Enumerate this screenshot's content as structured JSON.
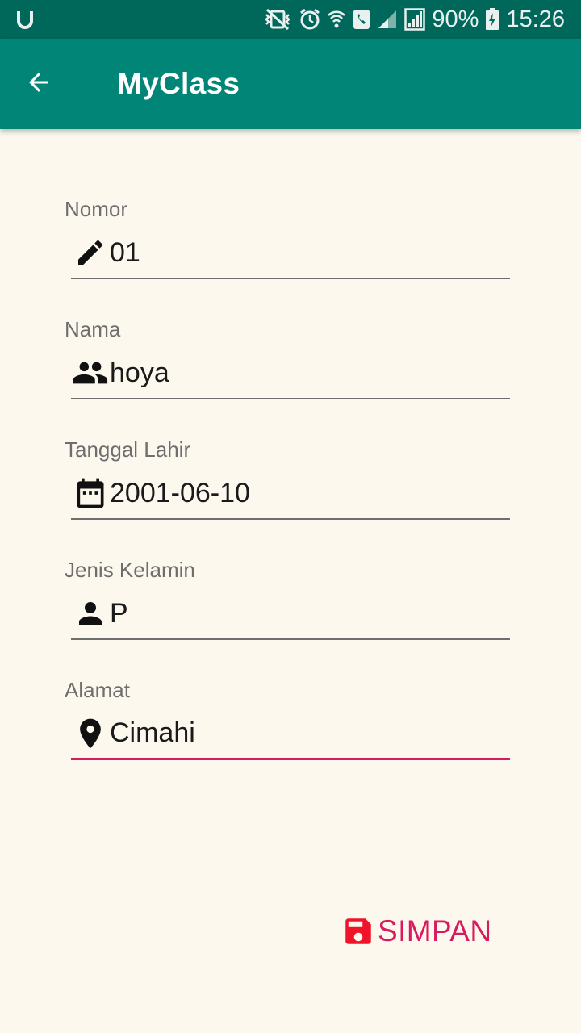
{
  "status_bar": {
    "left_icon": "u-icon",
    "battery": "90%",
    "time": "15:26"
  },
  "app_bar": {
    "title": "MyClass",
    "back_icon": "arrow-back-icon"
  },
  "form": {
    "fields": [
      {
        "label": "Nomor",
        "value": "01",
        "icon": "pencil-icon"
      },
      {
        "label": "Nama",
        "value": "hoya",
        "icon": "people-icon"
      },
      {
        "label": "Tanggal Lahir",
        "value": "2001-06-10",
        "icon": "calendar-icon"
      },
      {
        "label": "Jenis Kelamin",
        "value": "P",
        "icon": "person-icon"
      },
      {
        "label": "Alamat",
        "value": "Cimahi",
        "icon": "location-pin-icon"
      }
    ]
  },
  "actions": {
    "save_label": "SIMPAN",
    "save_icon": "floppy-disk-icon"
  },
  "colors": {
    "primary": "#008577",
    "primary_dark": "#00675B",
    "accent": "#D81B60",
    "background": "#FCF8EE",
    "save_icon": "#F0142B"
  }
}
